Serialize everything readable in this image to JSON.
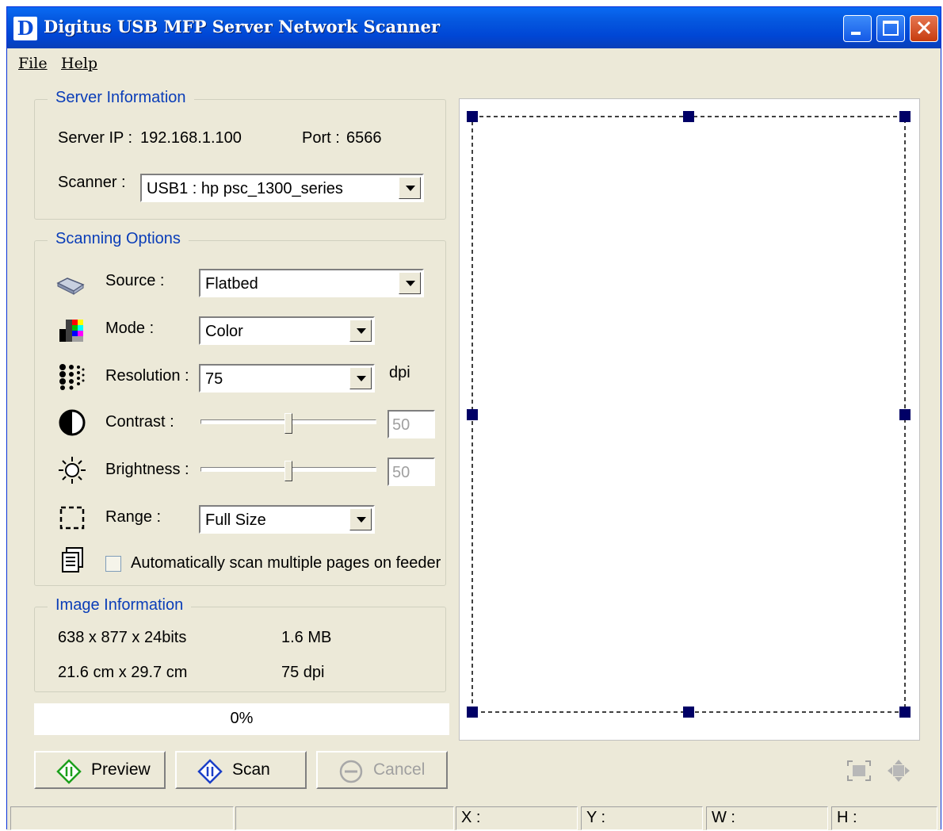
{
  "window": {
    "title": "Digitus USB MFP Server Network Scanner",
    "icon_letter": "D"
  },
  "menu": {
    "file": "File",
    "help": "Help"
  },
  "server_info": {
    "title": "Server Information",
    "server_ip_label": "Server IP :",
    "server_ip": "192.168.1.100",
    "port_label": "Port :",
    "port": "6566",
    "scanner_label": "Scanner :",
    "scanner_value": "USB1 : hp psc_1300_series"
  },
  "scanning_options": {
    "title": "Scanning Options",
    "source_label": "Source :",
    "source_value": "Flatbed",
    "mode_label": "Mode :",
    "mode_value": "Color",
    "resolution_label": "Resolution :",
    "resolution_value": "75",
    "resolution_unit": "dpi",
    "contrast_label": "Contrast :",
    "contrast_value": "50",
    "brightness_label": "Brightness :",
    "brightness_value": "50",
    "range_label": "Range :",
    "range_value": "Full Size",
    "auto_scan_label": "Automatically scan multiple pages on feeder",
    "auto_scan_checked": false
  },
  "image_info": {
    "title": "Image Information",
    "pixels": "638 x 877 x 24bits",
    "size": "1.6 MB",
    "dimensions": "21.6 cm x 29.7 cm",
    "dpi": "75 dpi"
  },
  "progress": {
    "text": "0%",
    "value": 0
  },
  "buttons": {
    "preview": "Preview",
    "scan": "Scan",
    "cancel": "Cancel"
  },
  "statusbar": {
    "x": "X :",
    "y": "Y :",
    "w": "W :",
    "h": "H :"
  },
  "colors": {
    "titlebar": "#0046d5",
    "group_title": "#0a3db8",
    "handle": "#000066",
    "face": "#ece9d8"
  }
}
